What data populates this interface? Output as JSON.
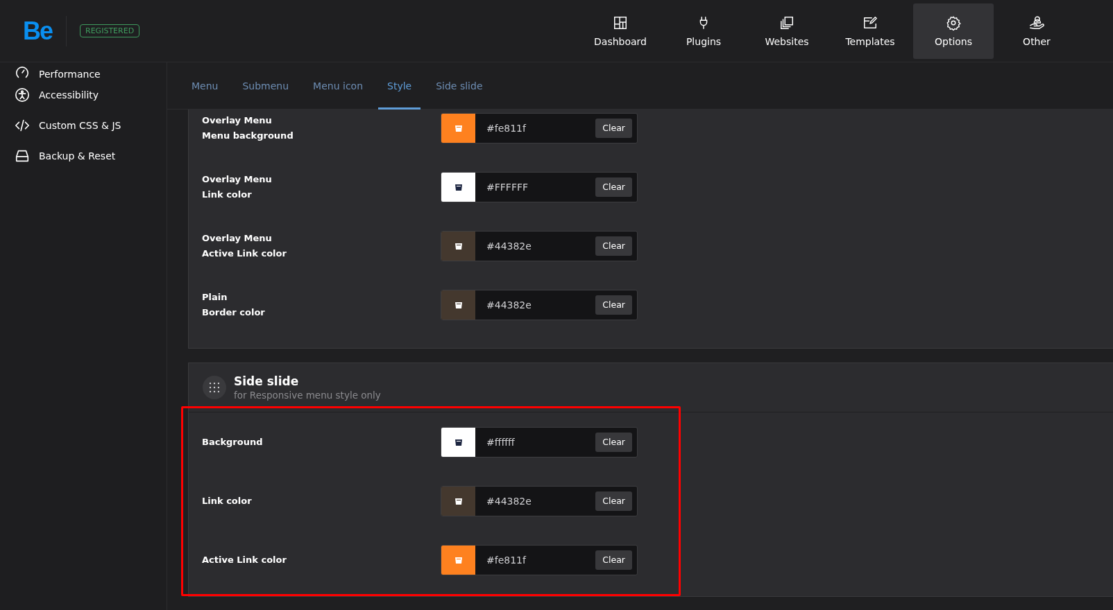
{
  "header": {
    "logo": "Be",
    "badge": "REGISTERED",
    "nav": [
      {
        "label": "Dashboard",
        "selected": false
      },
      {
        "label": "Plugins",
        "selected": false
      },
      {
        "label": "Websites",
        "selected": false
      },
      {
        "label": "Templates",
        "selected": false
      },
      {
        "label": "Options",
        "selected": true
      },
      {
        "label": "Other",
        "selected": false
      }
    ]
  },
  "sidebar": {
    "items": [
      {
        "label": "Performance"
      },
      {
        "label": "Accessibility"
      },
      {
        "label": "Custom CSS & JS"
      },
      {
        "label": "Backup & Reset"
      }
    ]
  },
  "tabs": [
    {
      "label": "Menu",
      "selected": false
    },
    {
      "label": "Submenu",
      "selected": false
    },
    {
      "label": "Menu icon",
      "selected": false
    },
    {
      "label": "Style",
      "selected": true
    },
    {
      "label": "Side slide",
      "selected": false
    }
  ],
  "sections": [
    {
      "highlighted": false,
      "rows": [
        {
          "label_lines": [
            "Overlay Menu",
            "Menu background"
          ],
          "color": "#fe811f",
          "value": "#fe811f",
          "button": "Clear"
        },
        {
          "label_lines": [
            "Overlay Menu",
            "Link color"
          ],
          "color": "#ffffff",
          "value": "#FFFFFF",
          "button": "Clear"
        },
        {
          "label_lines": [
            "Overlay Menu",
            "Active Link color"
          ],
          "color": "#44382e",
          "value": "#44382e",
          "button": "Clear"
        },
        {
          "label_lines": [
            "Plain",
            "Border color"
          ],
          "color": "#44382e",
          "value": "#44382e",
          "button": "Clear"
        }
      ]
    },
    {
      "title": "Side slide",
      "subtitle": "for Responsive menu style only",
      "highlighted": true,
      "rows": [
        {
          "label_lines": [
            "Background"
          ],
          "color": "#ffffff",
          "value": "#ffffff",
          "button": "Clear"
        },
        {
          "label_lines": [
            "Link color"
          ],
          "color": "#44382e",
          "value": "#44382e",
          "button": "Clear"
        },
        {
          "label_lines": [
            "Active Link color"
          ],
          "color": "#fe811f",
          "value": "#fe811f",
          "button": "Clear"
        }
      ]
    }
  ]
}
